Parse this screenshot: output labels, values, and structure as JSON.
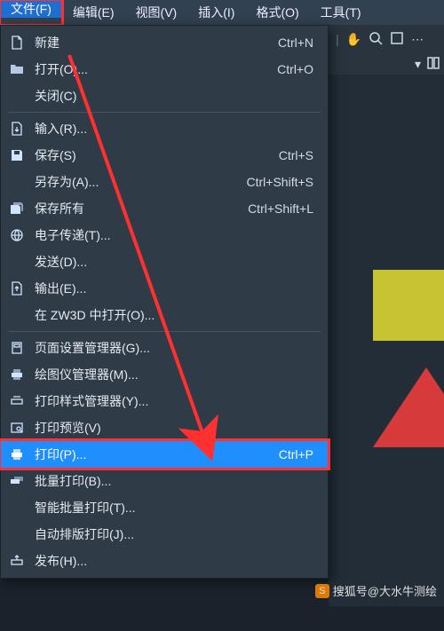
{
  "menubar": {
    "file": "文件(F)",
    "edit": "编辑(E)",
    "view": "视图(V)",
    "insert": "插入(I)",
    "format": "格式(O)",
    "tools": "工具(T)"
  },
  "menu": {
    "new": {
      "label": "新建",
      "shortcut": "Ctrl+N"
    },
    "open": {
      "label": "打开(O)...",
      "shortcut": "Ctrl+O"
    },
    "close": {
      "label": "关闭(C)",
      "shortcut": ""
    },
    "import": {
      "label": "输入(R)...",
      "shortcut": ""
    },
    "save": {
      "label": "保存(S)",
      "shortcut": "Ctrl+S"
    },
    "saveas": {
      "label": "另存为(A)...",
      "shortcut": "Ctrl+Shift+S"
    },
    "saveall": {
      "label": "保存所有",
      "shortcut": "Ctrl+Shift+L"
    },
    "etransmit": {
      "label": "电子传递(T)...",
      "shortcut": ""
    },
    "send": {
      "label": "发送(D)...",
      "shortcut": ""
    },
    "export": {
      "label": "输出(E)...",
      "shortcut": ""
    },
    "openzw3d": {
      "label": "在 ZW3D 中打开(O)...",
      "shortcut": ""
    },
    "pagesetup": {
      "label": "页面设置管理器(G)...",
      "shortcut": ""
    },
    "plotter": {
      "label": "绘图仪管理器(M)...",
      "shortcut": ""
    },
    "plotstyle": {
      "label": "打印样式管理器(Y)...",
      "shortcut": ""
    },
    "preview": {
      "label": "打印预览(V)",
      "shortcut": ""
    },
    "print": {
      "label": "打印(P)...",
      "shortcut": "Ctrl+P"
    },
    "batchprint": {
      "label": "批量打印(B)...",
      "shortcut": ""
    },
    "smartbatch": {
      "label": "智能批量打印(T)...",
      "shortcut": ""
    },
    "autolayout": {
      "label": "自动排版打印(J)...",
      "shortcut": ""
    },
    "publish": {
      "label": "发布(H)...",
      "shortcut": ""
    }
  },
  "watermark": "搜狐号@大水牛测绘",
  "toolbar2_arrow": "▾"
}
